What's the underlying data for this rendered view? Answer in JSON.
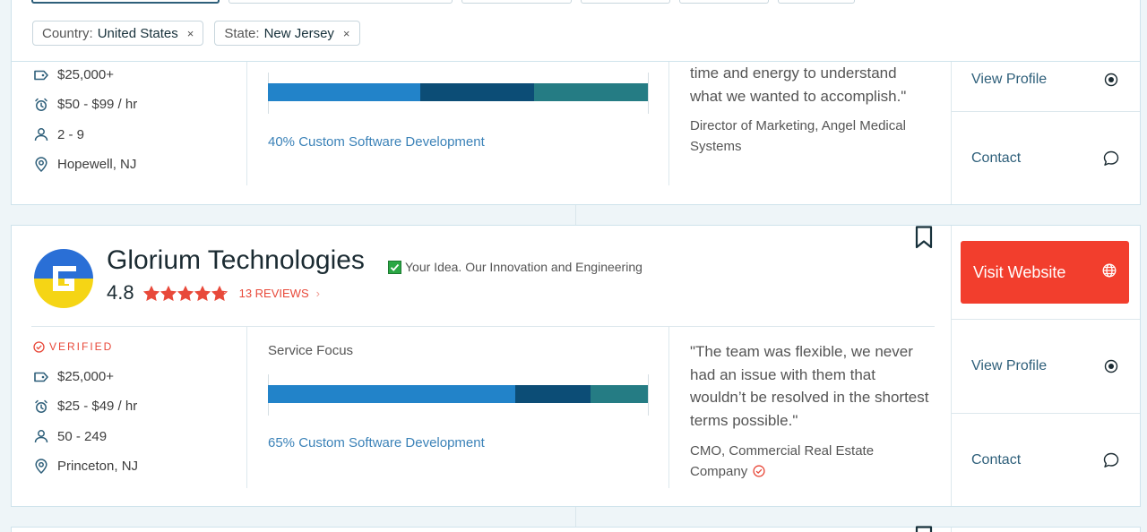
{
  "filters": {
    "chips": [
      {
        "key": "Country:",
        "value": "United States",
        "remove": "×"
      },
      {
        "key": "State:",
        "value": "New Jersey",
        "remove": "×"
      }
    ]
  },
  "card1": {
    "info": {
      "min_project": "$25,000+",
      "hourly_rate": "$50 - $99 / hr",
      "employees": "2 - 9",
      "location": "Hopewell, NJ"
    },
    "service_focus": {
      "label": "40% Custom Software Development",
      "segments": [
        {
          "percent": 40,
          "color": "#2283c9"
        },
        {
          "percent": 30,
          "color": "#0c4d76"
        },
        {
          "percent": 30,
          "color": "#257c84"
        }
      ]
    },
    "quote": "time and energy to understand what we wanted to accomplish.\"",
    "reviewer": "Director of Marketing, Angel Medical Systems",
    "actions": {
      "view_profile": "View Profile",
      "contact": "Contact"
    }
  },
  "card2": {
    "company_name": "Glorium Technologies",
    "tagline": "Your Idea. Our Innovation and Engineering",
    "rating": "4.8",
    "stars": 4.8,
    "reviews": "13 REVIEWS",
    "reviews_chevron": "›",
    "verified": "VERIFIED",
    "service_focus_title": "Service Focus",
    "info": {
      "min_project": "$25,000+",
      "hourly_rate": "$25 - $49 / hr",
      "employees": "50 - 249",
      "location": "Princeton, NJ"
    },
    "service_focus": {
      "label": "65% Custom Software Development",
      "segments": [
        {
          "percent": 65,
          "color": "#2283c9"
        },
        {
          "percent": 20,
          "color": "#0c4d76"
        },
        {
          "percent": 15,
          "color": "#257c84"
        }
      ]
    },
    "quote": "\"The team was flexible, we never had an issue with them that wouldn’t be resolved in the shortest terms possible.\"",
    "reviewer": "CMO, Commercial Real Estate Company",
    "actions": {
      "visit_website": "Visit Website",
      "view_profile": "View Profile",
      "contact": "Contact"
    }
  },
  "colors": {
    "accent_red": "#f23e2d",
    "link_blue": "#2e5f7a",
    "star_red": "#e8493a",
    "border": "#cfe3ec"
  },
  "icons": [
    "tag-icon",
    "alarm-clock-icon",
    "user-icon",
    "location-pin-icon",
    "globe-icon",
    "target-icon",
    "chat-bubble-icon",
    "bookmark-icon",
    "check-circle-icon",
    "star-icon"
  ]
}
